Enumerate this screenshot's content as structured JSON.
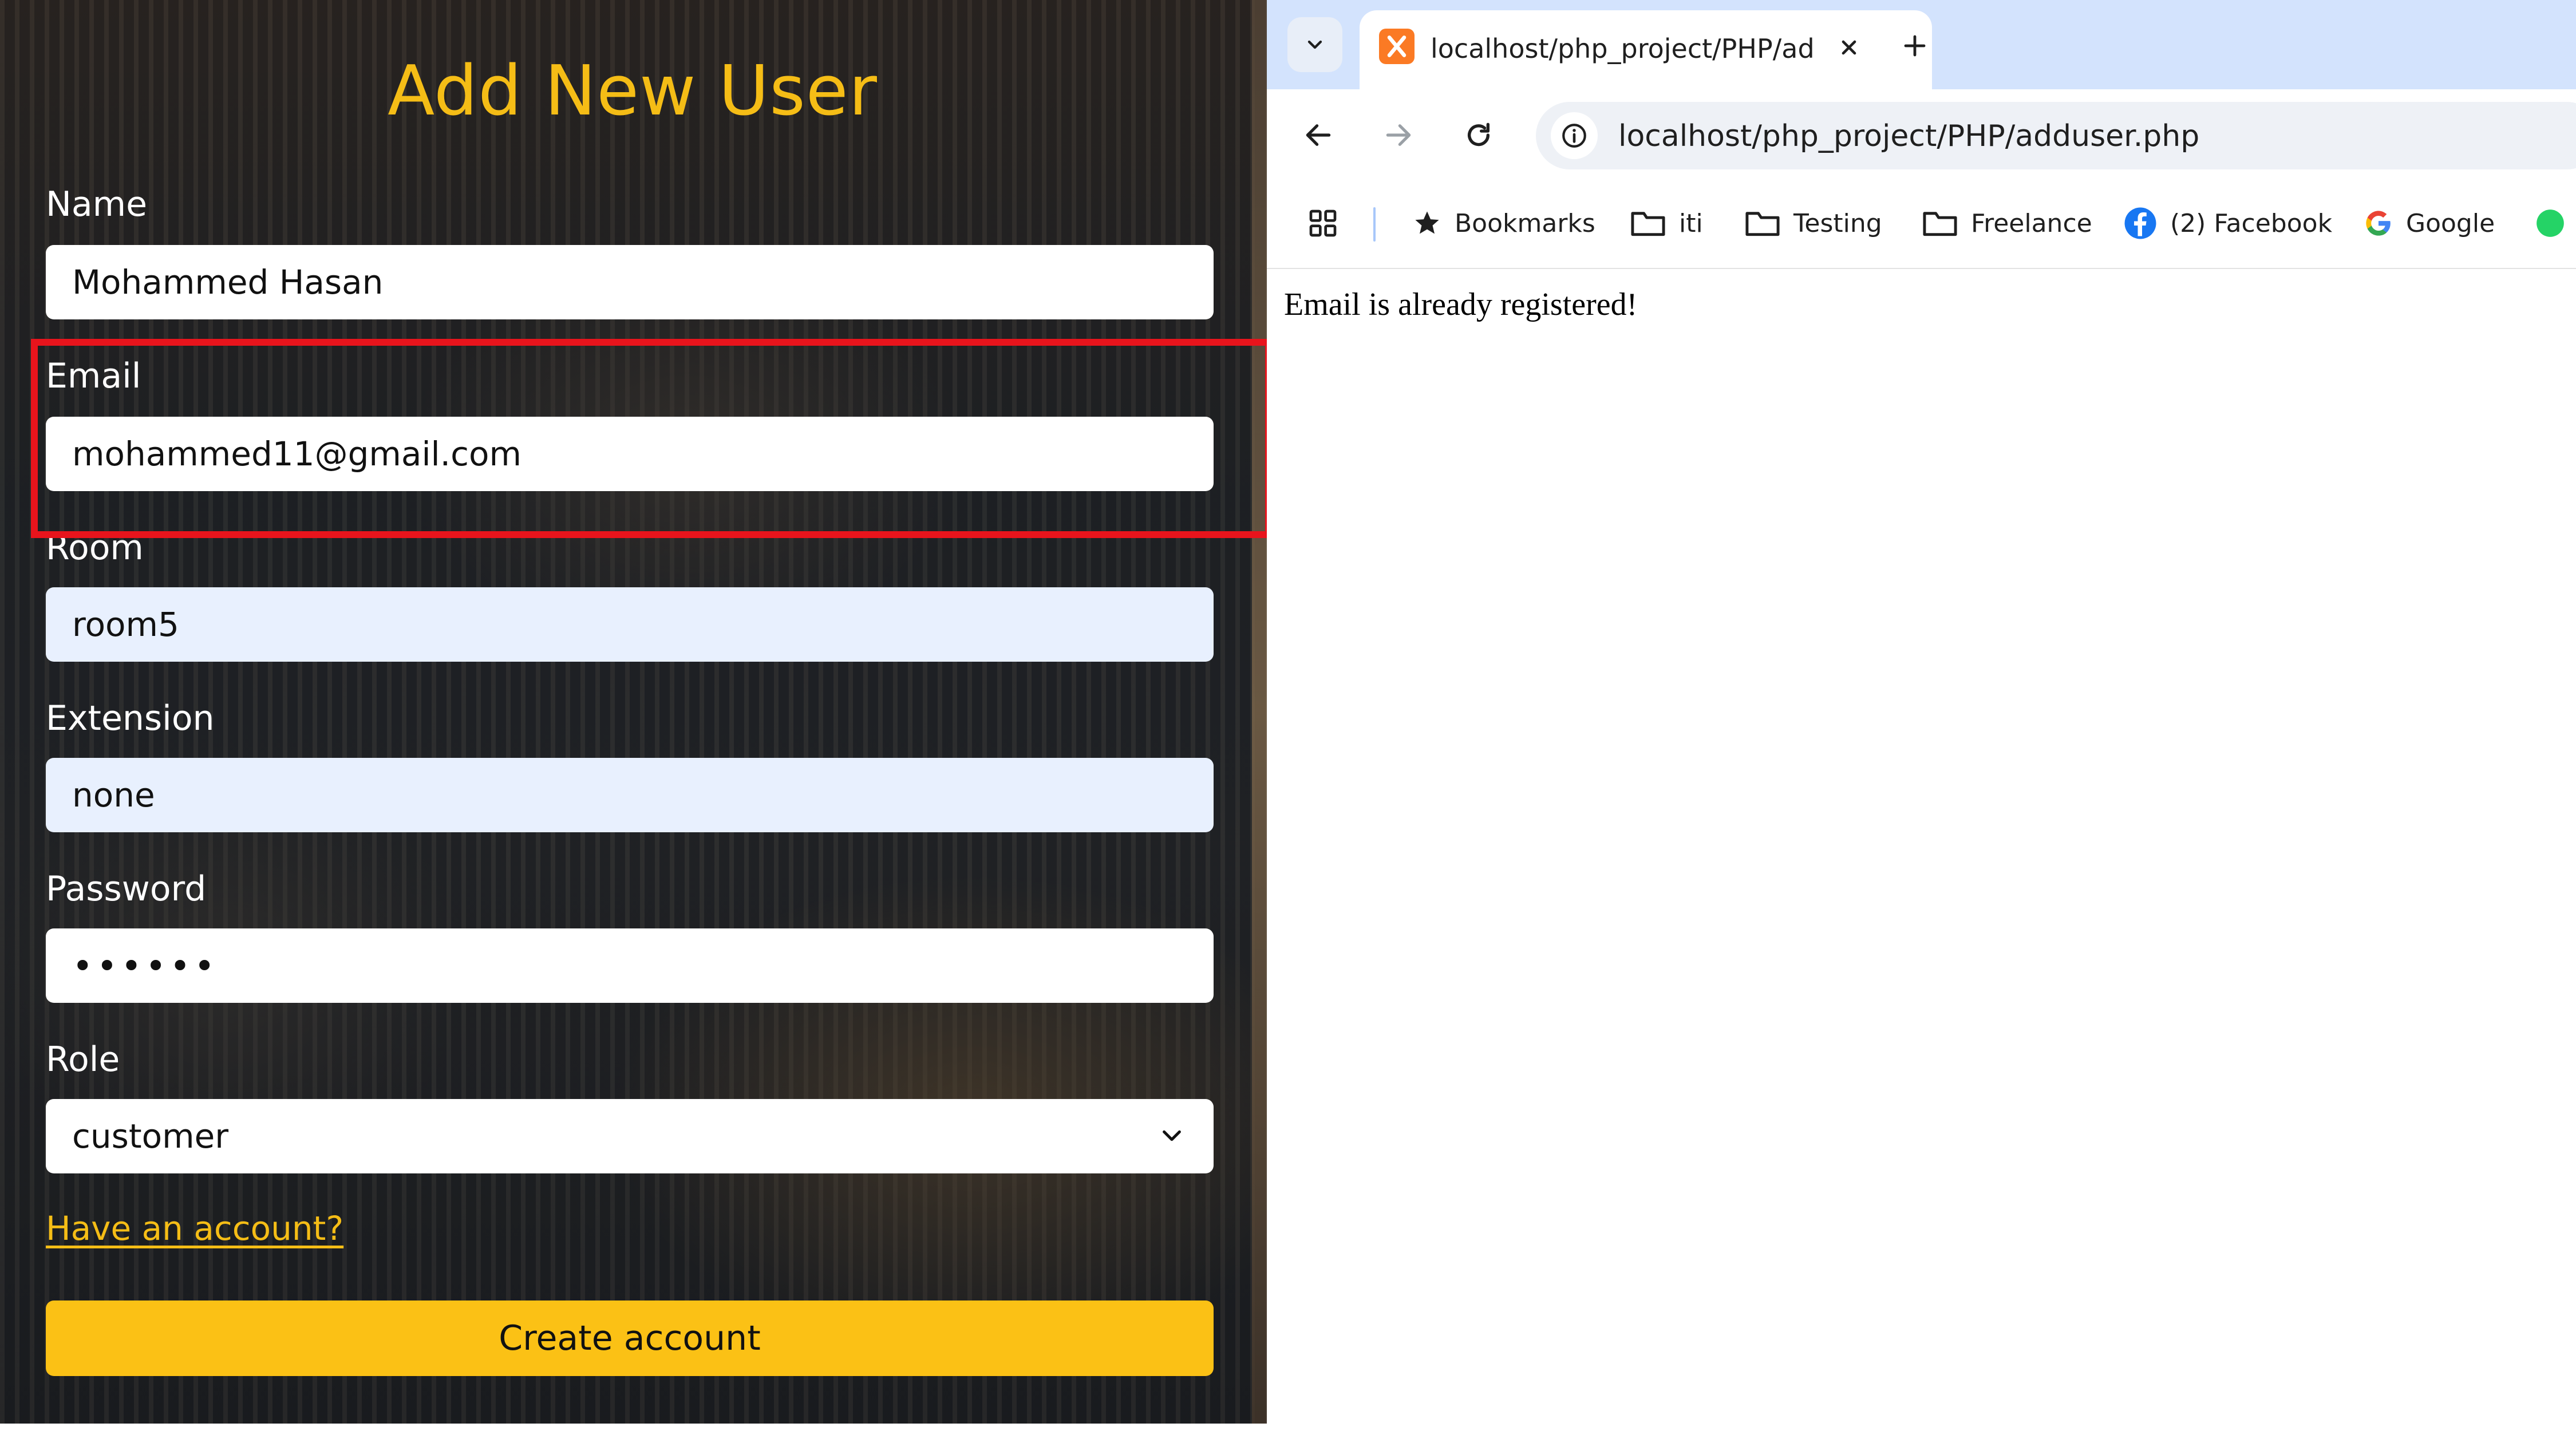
{
  "form": {
    "title": "Add New User",
    "fields": {
      "name": {
        "label": "Name",
        "value": "Mohammed Hasan"
      },
      "email": {
        "label": "Email",
        "value": "mohammed11@gmail.com"
      },
      "room": {
        "label": "Room",
        "value": "room5"
      },
      "extension": {
        "label": "Extension",
        "value": "none"
      },
      "password": {
        "label": "Password",
        "value": "••••••"
      },
      "role": {
        "label": "Role",
        "value": "customer"
      }
    },
    "have_account_link": "Have an account?",
    "create_button": "Create account",
    "highlight_color": "#e8141c",
    "accent_color": "#f5bd16"
  },
  "browser": {
    "tab": {
      "title": "localhost/php_project/PHP/adduser.php",
      "icon": "xampp-icon"
    },
    "address_bar": {
      "url": "localhost/php_project/PHP/adduser.php"
    },
    "bookmarks": [
      {
        "label": "Bookmarks",
        "icon": "star-icon"
      },
      {
        "label": "iti",
        "icon": "folder-icon"
      },
      {
        "label": "Testing",
        "icon": "folder-icon"
      },
      {
        "label": "Freelance",
        "icon": "folder-icon"
      },
      {
        "label": "(2) Facebook",
        "icon": "facebook-icon"
      },
      {
        "label": "Google",
        "icon": "google-icon"
      }
    ],
    "page_message": "Email is already registered!"
  }
}
